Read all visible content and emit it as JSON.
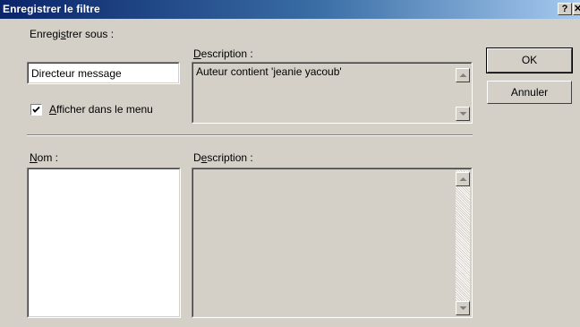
{
  "window": {
    "title": "Enregistrer le filtre",
    "help_label": "?",
    "close_label": "✕"
  },
  "save_section": {
    "save_as_label": "Enregistrer sous :",
    "save_as_value": "Directeur message",
    "description_label": "Description :",
    "description_value": "Auteur  contient 'jeanie yacoub'",
    "show_in_menu_label": "Afficher dans le menu",
    "show_in_menu_checked": true
  },
  "list_section": {
    "name_label": "Nom :",
    "description_label": "Description :"
  },
  "buttons": {
    "ok_label": "OK",
    "cancel_label": "Annuler"
  },
  "icons": [
    "help-icon",
    "close-icon",
    "checkmark-icon",
    "scroll-up-arrow-icon",
    "scroll-down-arrow-icon"
  ]
}
